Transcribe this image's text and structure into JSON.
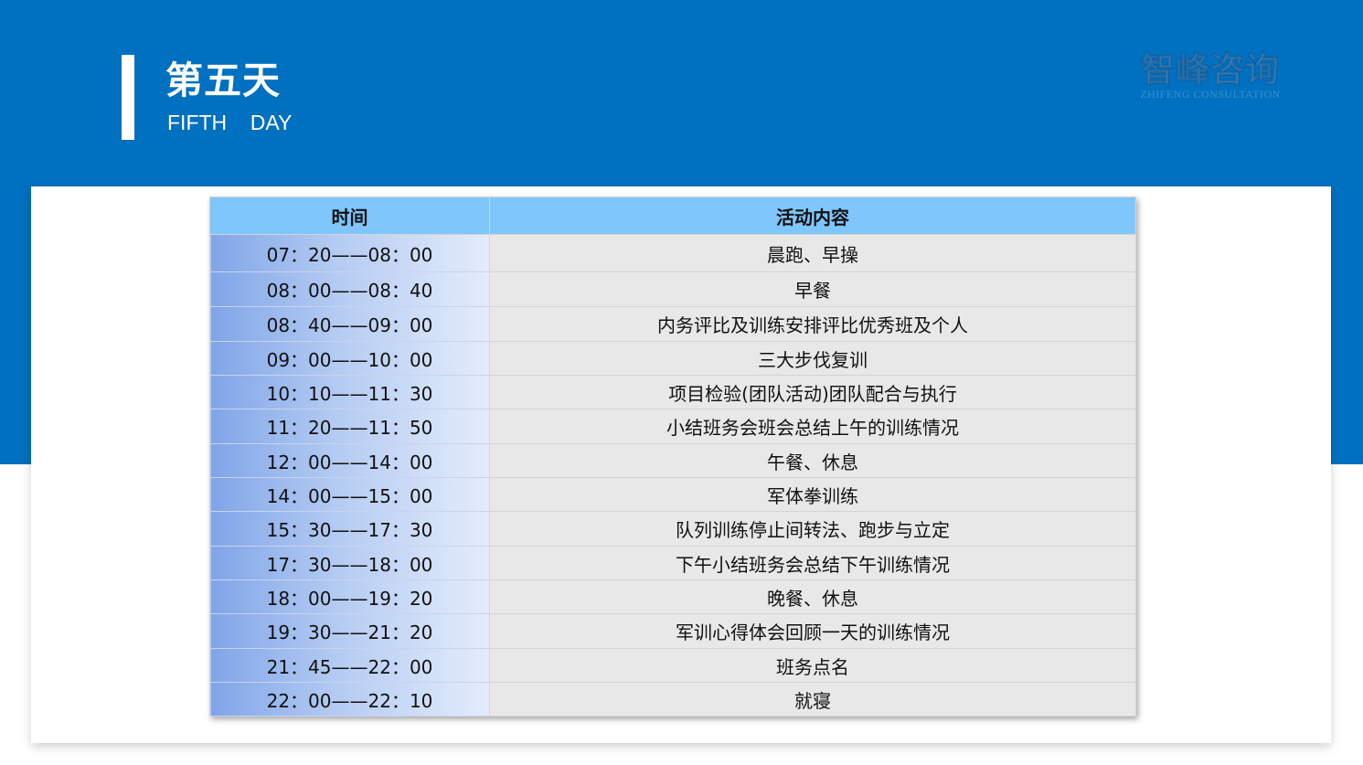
{
  "header": {
    "title_cn": "第五天",
    "title_en": "FIFTH    DAY",
    "brand_cn": "智峰咨询",
    "brand_en": "ZHIFENG CONSULTATION"
  },
  "colors": {
    "primary_band": "#0070c0",
    "table_header": "#7fc6fc",
    "activity_cell": "#e8e8e8"
  },
  "table": {
    "headers": [
      "时间",
      "活动内容"
    ],
    "rows": [
      {
        "time": "07：20——08：00",
        "activity": "晨跑、早操"
      },
      {
        "time": "08：00——08：40",
        "activity": "早餐"
      },
      {
        "time": "08：40——09：00",
        "activity": "内务评比及训练安排评比优秀班及个人"
      },
      {
        "time": "09：00——10：00",
        "activity": "三大步伐复训"
      },
      {
        "time": "10：10——11：30",
        "activity": "项目检验(团队活动)团队配合与执行"
      },
      {
        "time": "11：20——11：50",
        "activity": "小结班务会班会总结上午的训练情况"
      },
      {
        "time": "12：00——14：00",
        "activity": "午餐、休息"
      },
      {
        "time": "14：00——15：00",
        "activity": "军体拳训练"
      },
      {
        "time": "15：30——17：30",
        "activity": "队列训练停止间转法、跑步与立定"
      },
      {
        "time": "17：30——18：00",
        "activity": "下午小结班务会总结下午训练情况"
      },
      {
        "time": "18：00——19：20",
        "activity": "晚餐、休息"
      },
      {
        "time": "19：30——21：20",
        "activity": "军训心得体会回顾一天的训练情况"
      },
      {
        "time": "21：45——22：00",
        "activity": "班务点名"
      },
      {
        "time": "22：00——22：10",
        "activity": "就寝"
      }
    ]
  }
}
